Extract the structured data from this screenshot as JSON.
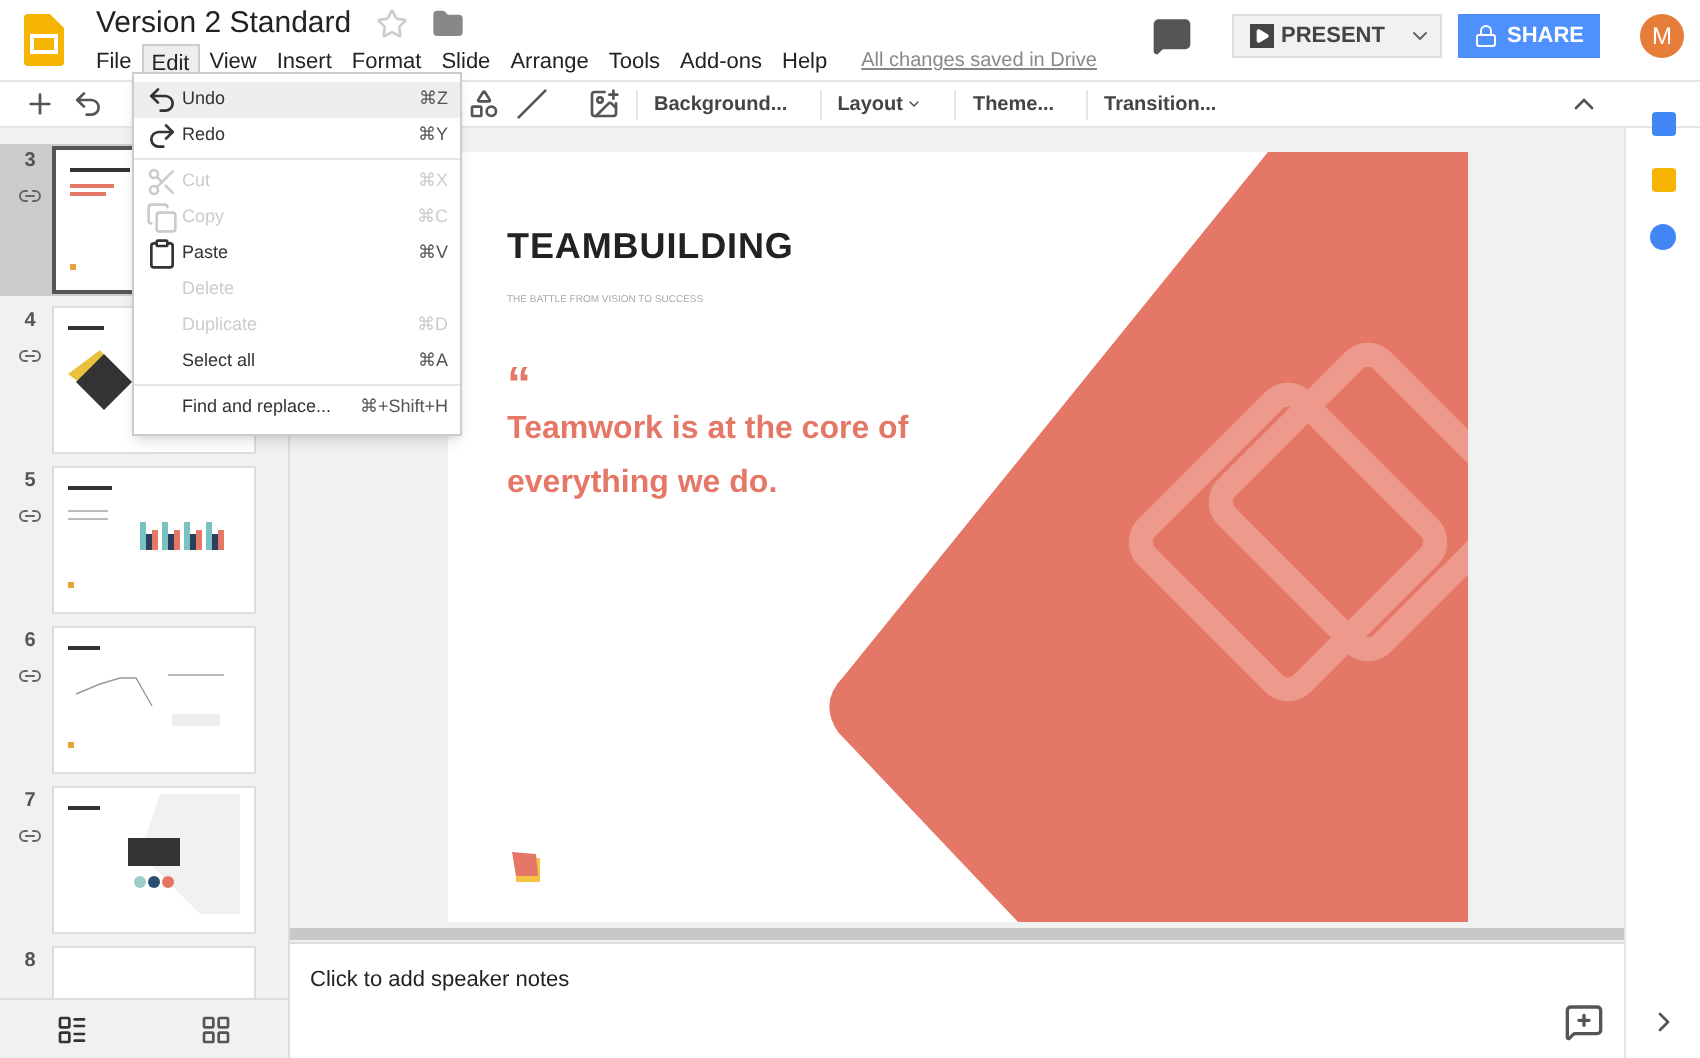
{
  "document": {
    "title": "Version 2 Standard",
    "starred": false,
    "save_status": "All changes saved in Drive"
  },
  "menu_bar": [
    {
      "label": "File",
      "selected": false
    },
    {
      "label": "Edit",
      "selected": true
    },
    {
      "label": "View",
      "selected": false
    },
    {
      "label": "Insert",
      "selected": false
    },
    {
      "label": "Format",
      "selected": false
    },
    {
      "label": "Slide",
      "selected": false
    },
    {
      "label": "Arrange",
      "selected": false
    },
    {
      "label": "Tools",
      "selected": false
    },
    {
      "label": "Add-ons",
      "selected": false
    },
    {
      "label": "Help",
      "selected": false
    }
  ],
  "header_buttons": {
    "present": "PRESENT",
    "share": "SHARE",
    "avatar": "M"
  },
  "toolbar": [
    {
      "label": "Background...",
      "caret": false
    },
    {
      "label": "Layout",
      "caret": true
    },
    {
      "label": "Theme...",
      "caret": false
    },
    {
      "label": "Transition...",
      "caret": false
    }
  ],
  "edit_menu": [
    [
      {
        "kind": "undo",
        "label": "Undo",
        "shortcut": "⌘Z",
        "disabled": false,
        "selected": true
      },
      {
        "kind": "redo",
        "label": "Redo",
        "shortcut": "⌘Y",
        "disabled": false,
        "selected": false
      }
    ],
    [
      {
        "kind": "cut",
        "label": "Cut",
        "shortcut": "⌘X",
        "disabled": true,
        "selected": false
      },
      {
        "kind": "copy",
        "label": "Copy",
        "shortcut": "⌘C",
        "disabled": true,
        "selected": false
      },
      {
        "kind": "paste",
        "label": "Paste",
        "shortcut": "⌘V",
        "disabled": false,
        "selected": false
      },
      {
        "kind": "plain",
        "label": "Delete",
        "disabled": true,
        "selected": false
      },
      {
        "kind": "plain",
        "label": "Duplicate",
        "shortcut": "⌘D",
        "disabled": true,
        "selected": false
      },
      {
        "kind": "plain",
        "label": "Select all",
        "shortcut": "⌘A",
        "disabled": false,
        "selected": false
      }
    ],
    [
      {
        "kind": "plain",
        "label": "Find and replace...",
        "shortcut": "⌘+Shift+H",
        "disabled": false,
        "selected": false
      }
    ]
  ],
  "slides": [
    {
      "number": "3",
      "kind": "title",
      "selected": true
    },
    {
      "number": "4",
      "kind": "diamond",
      "selected": false
    },
    {
      "number": "5",
      "kind": "bar",
      "selected": false
    },
    {
      "number": "6",
      "kind": "line",
      "selected": false
    },
    {
      "number": "7",
      "kind": "showcase",
      "selected": false
    },
    {
      "number": "8",
      "kind": "blank",
      "selected": false
    }
  ],
  "slide": {
    "title": "TEAMBUILDING",
    "subtitle": "THE BATTLE FROM VISION TO SUCCESS",
    "quote_mark": "“",
    "quote": "Teamwork is at the core of everything we do."
  },
  "speaker_notes": {
    "placeholder": "Click to add speaker notes"
  }
}
